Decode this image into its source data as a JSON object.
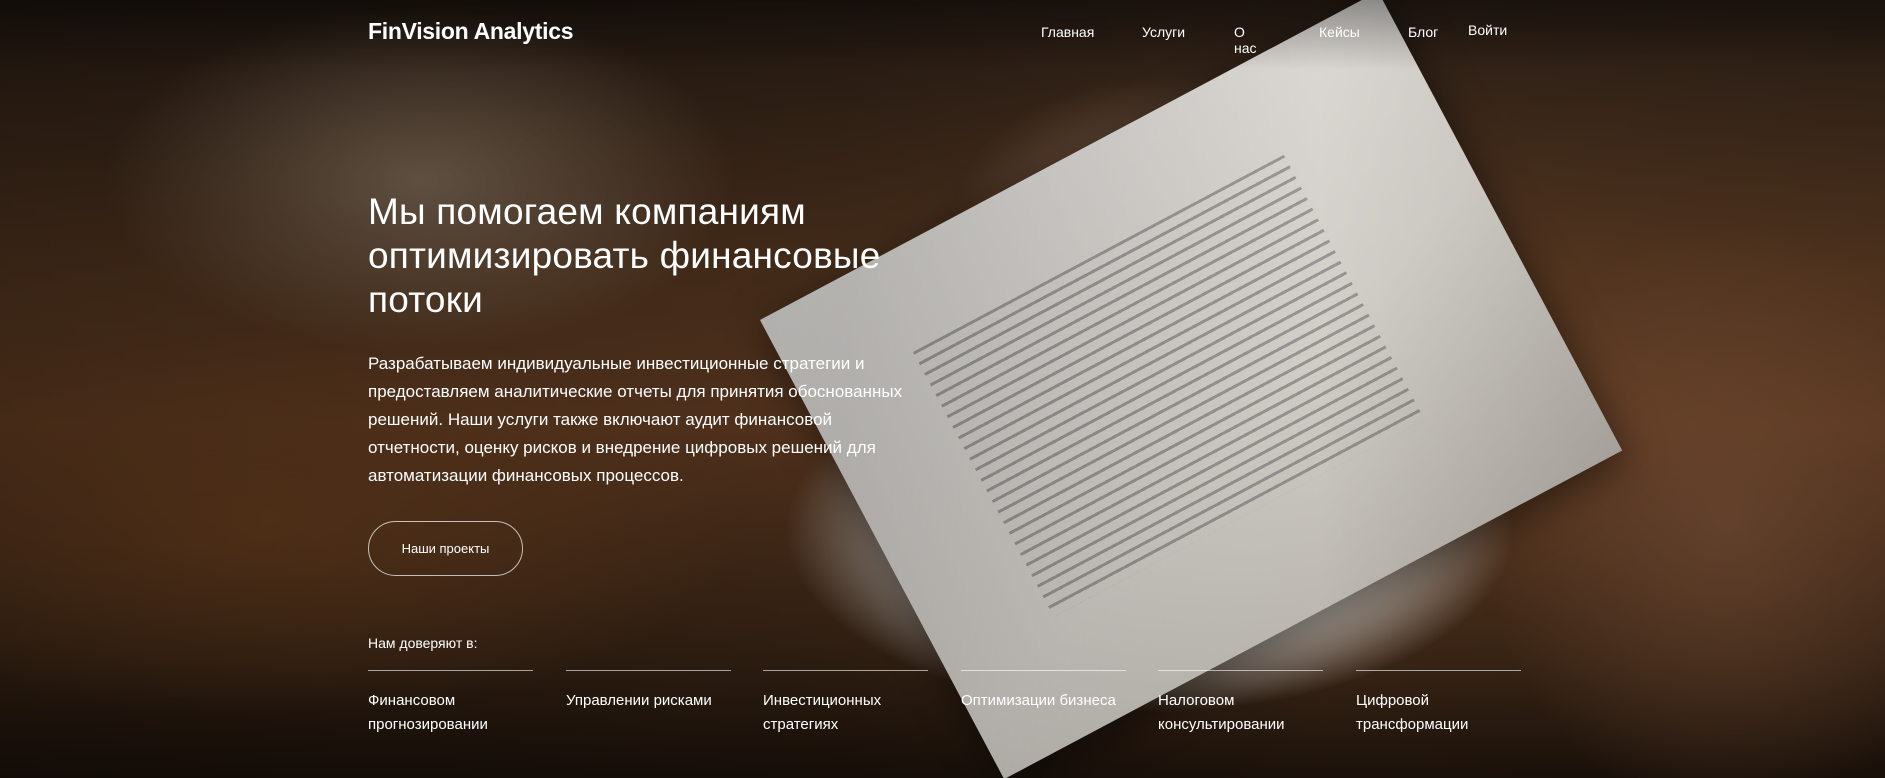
{
  "header": {
    "logo": "FinVision Analytics",
    "nav": [
      "Главная",
      "Услуги",
      "О нас",
      "Кейсы",
      "Блог"
    ],
    "login": "Войти"
  },
  "hero": {
    "headline": "Мы помогаем компаниям оптимизировать финансовые потоки",
    "lead": "Разрабатываем индивидуальные инвестиционные стратегии и предоставляем аналитические отчеты для принятия обоснованных решений. Наши услуги также включают аудит финансовой отчетности, оценку рисков и внедрение цифровых решений для автоматизации финансовых процессов.",
    "cta": "Наши проекты"
  },
  "trust": {
    "label": "Нам доверяют в:",
    "items": [
      "Финансовом прогнозировании",
      "Управлении рисками",
      "Инвестиционных стратегиях",
      "Оптимизации бизнеса",
      "Налоговом консультировании",
      "Цифровой трансформации"
    ]
  }
}
